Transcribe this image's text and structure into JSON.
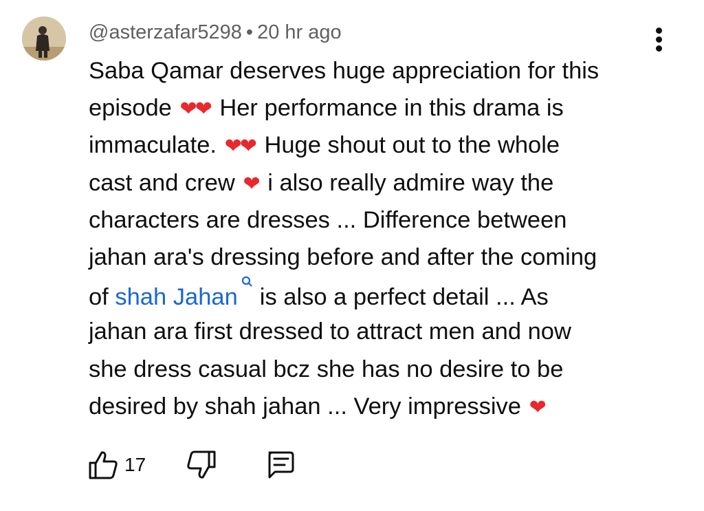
{
  "comment": {
    "author": "@asterzafar5298",
    "separator": "•",
    "timestamp": "20 hr ago",
    "avatar_icon": "user-avatar",
    "menu_icon": "more-vertical-icon",
    "lines": {
      "l1": "Saba Qamar deserves huge appreciation for this",
      "l2a": "episode",
      "l2b": "Her performance in this drama is",
      "l3a": "immaculate.",
      "l3b": "Huge shout out to the whole",
      "l4a": "cast and crew",
      "l4b": "i also really admire way the",
      "l5": "characters are dresses ... Difference between",
      "l6": "jahan ara's dressing before and after the coming",
      "l7a": "of",
      "l7_link": "shah Jahan",
      "l7b": "is also a perfect detail ... As",
      "l8": "jahan ara first dressed to attract men and now",
      "l9": "she dress casual bcz she has no desire to be",
      "l10a": "desired by shah jahan ... Very impressive"
    },
    "emoji": {
      "double_heart": "❤❤",
      "heart": "❤"
    },
    "link_color": "#1967d2",
    "heart_color": "#e8282d",
    "actions": {
      "like_count": "17",
      "like_icon": "thumbs-up-icon",
      "dislike_icon": "thumbs-down-icon",
      "reply_icon": "reply-comment-icon"
    }
  }
}
